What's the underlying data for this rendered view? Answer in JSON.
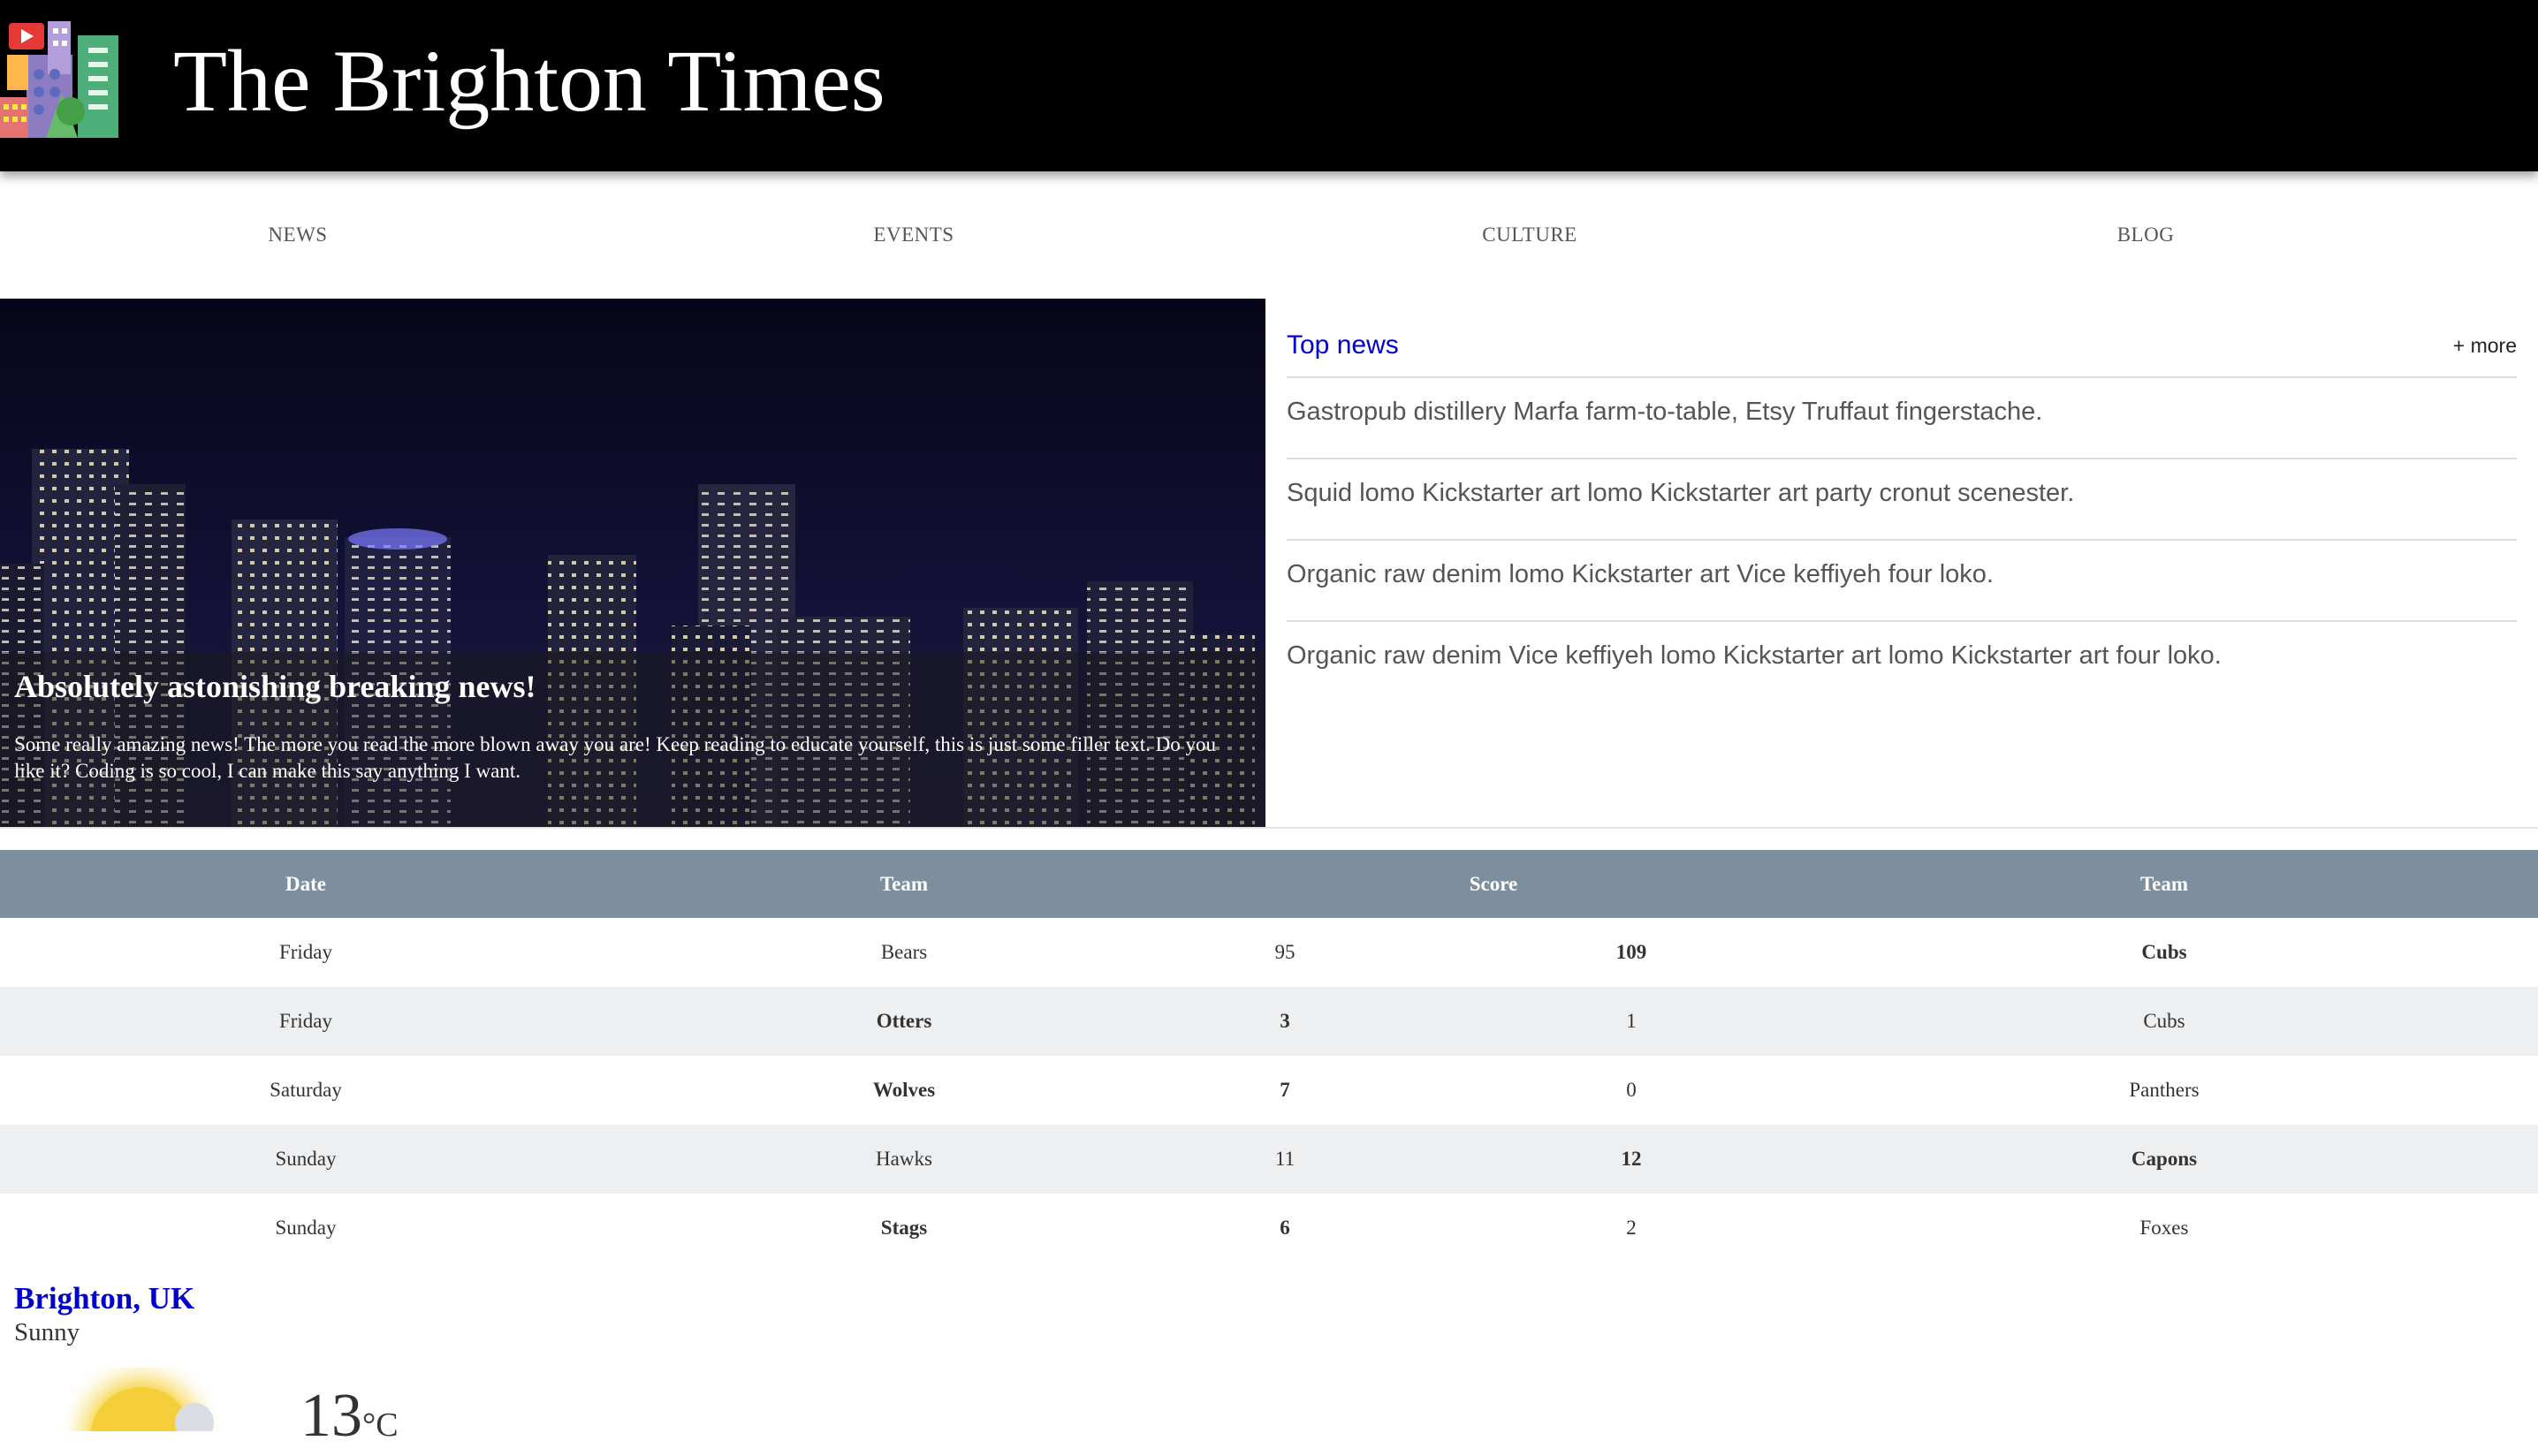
{
  "site": {
    "title": "The Brighton Times"
  },
  "nav": {
    "items": [
      "NEWS",
      "EVENTS",
      "CULTURE",
      "BLOG"
    ]
  },
  "hero": {
    "headline": "Absolutely astonishing breaking news!",
    "body": "Some really amazing news! The more you read the more blown away you are! Keep reading to educate yourself, this is just some filler text. Do you like it? Coding is so cool, I can make this say anything I want."
  },
  "top_news": {
    "title": "Top news",
    "more_label": "+ more",
    "items": [
      "Gastropub distillery Marfa farm-to-table, Etsy Truffaut fingerstache.",
      "Squid lomo Kickstarter art lomo Kickstarter art party cronut scenester.",
      "Organic raw denim lomo Kickstarter art Vice keffiyeh four loko.",
      "Organic raw denim Vice keffiyeh lomo Kickstarter art lomo Kickstarter art four loko."
    ]
  },
  "scores": {
    "headers": [
      "Date",
      "Team",
      "Score",
      "Team"
    ],
    "rows": [
      {
        "date": "Friday",
        "team1": "Bears",
        "score1": "95",
        "score2": "109",
        "team2": "Cubs",
        "winner": 2
      },
      {
        "date": "Friday",
        "team1": "Otters",
        "score1": "3",
        "score2": "1",
        "team2": "Cubs",
        "winner": 1
      },
      {
        "date": "Saturday",
        "team1": "Wolves",
        "score1": "7",
        "score2": "0",
        "team2": "Panthers",
        "winner": 1
      },
      {
        "date": "Sunday",
        "team1": "Hawks",
        "score1": "11",
        "score2": "12",
        "team2": "Capons",
        "winner": 2
      },
      {
        "date": "Sunday",
        "team1": "Stags",
        "score1": "6",
        "score2": "2",
        "team2": "Foxes",
        "winner": 1
      }
    ]
  },
  "weather": {
    "city": "Brighton, UK",
    "condition": "Sunny",
    "temperature": "13",
    "unit": "°C",
    "icon": "sun-cloud-icon"
  },
  "colors": {
    "header_bg": "#000000",
    "link_blue": "#0000cc",
    "table_header_bg": "#7d8f9e",
    "table_alt_row": "#eeeff1"
  }
}
